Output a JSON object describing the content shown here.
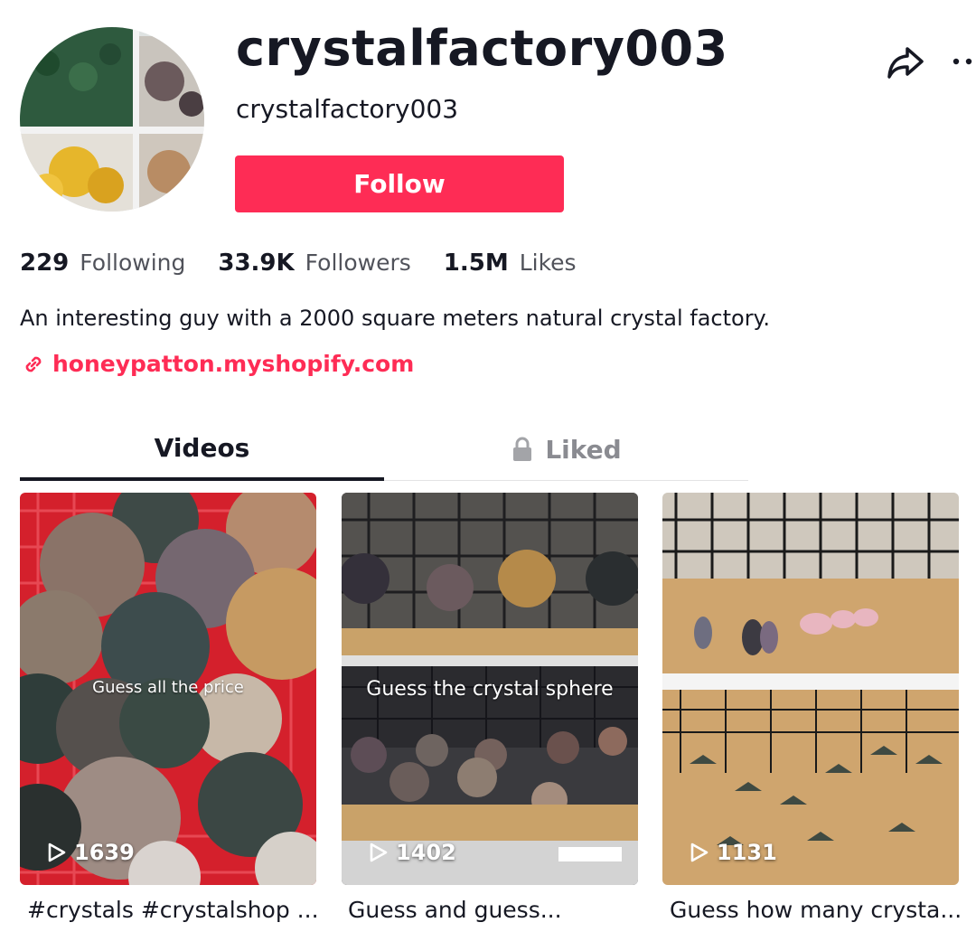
{
  "profile": {
    "username": "crystalfactory003",
    "nickname": "crystalfactory003",
    "follow_label": "Follow",
    "stats": [
      {
        "value": "229",
        "label": "Following"
      },
      {
        "value": "33.9K",
        "label": "Followers"
      },
      {
        "value": "1.5M",
        "label": "Likes"
      }
    ],
    "bio": "An interesting guy with a 2000 square meters natural crystal factory.",
    "link": "honeypatton.myshopify.com"
  },
  "tabs": [
    {
      "label": "Videos",
      "active": true
    },
    {
      "label": "Liked",
      "locked": true
    }
  ],
  "videos": [
    {
      "overlay": "Guess all the price",
      "plays": "1639",
      "caption": "#crystals #crystalshop ..."
    },
    {
      "overlay": "Guess the crystal sphere",
      "plays": "1402",
      "caption": "Guess and guess..."
    },
    {
      "overlay": "",
      "plays": "1131",
      "caption": "Guess how many crysta..."
    }
  ],
  "colors": {
    "accent": "#fe2c55",
    "text": "#161823"
  },
  "icons": [
    "share-icon",
    "more-icon",
    "link-icon",
    "lock-icon",
    "play-icon"
  ]
}
